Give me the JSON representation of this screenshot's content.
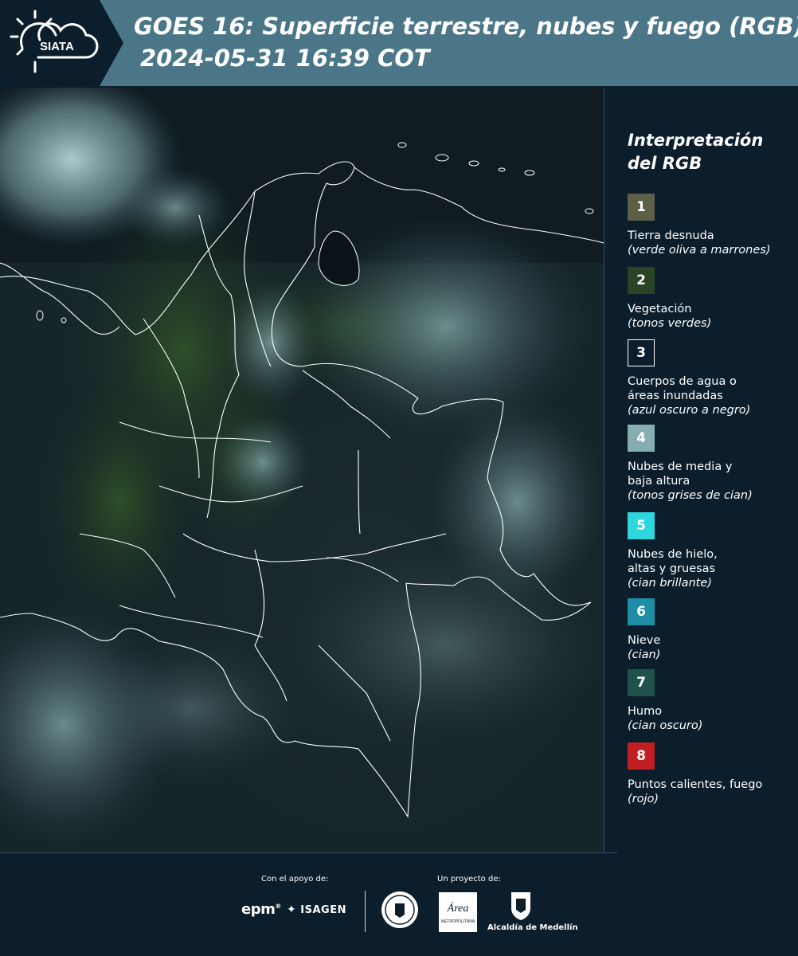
{
  "header": {
    "logo_text": "SIATA",
    "title": "GOES 16: Superficie terrestre, nubes y fuego (RGB)",
    "subtitle": "2024-05-31 16:39 COT",
    "bg_color": "#4a7688",
    "logo_bg_color": "#0c1e2c"
  },
  "legend": {
    "title_line1": "Interpretación",
    "title_line2": "del RGB",
    "items": [
      {
        "number": "1",
        "label": "Tierra desnuda",
        "desc": "(verde oliva a marrones)",
        "color": "#5e5f47"
      },
      {
        "number": "2",
        "label": "Vegetación",
        "desc": "(tonos verdes)",
        "color": "#2c4426"
      },
      {
        "number": "3",
        "label": "Cuerpos de agua o áreas inundadas",
        "desc": "(azul oscuro a negro)",
        "color": "#0c1e2c"
      },
      {
        "number": "4",
        "label": "Nubes de media y baja altura",
        "desc": "(tonos grises de cian)",
        "color": "#86aeb0"
      },
      {
        "number": "5",
        "label": "Nubes de hielo, altas y gruesas",
        "desc": "(cian brillante)",
        "color": "#2ed6de"
      },
      {
        "number": "6",
        "label": "Nieve",
        "desc": "(cian)",
        "color": "#1d8ea6"
      },
      {
        "number": "7",
        "label": "Humo",
        "desc": "(cian oscuro)",
        "color": "#20524c"
      },
      {
        "number": "8",
        "label": "Puntos calientes, fuego",
        "desc": "(rojo)",
        "color": "#c21f24"
      }
    ]
  },
  "footer": {
    "support_label": "Con el apoyo de:",
    "project_label": "Un proyecto de:",
    "epm_logo": "epm",
    "isagen_logo": "ISAGEN",
    "area_logo_main": "Área",
    "area_logo_sub": "METROPOLITANA",
    "medellin_label": "Alcaldía de Medellín"
  }
}
